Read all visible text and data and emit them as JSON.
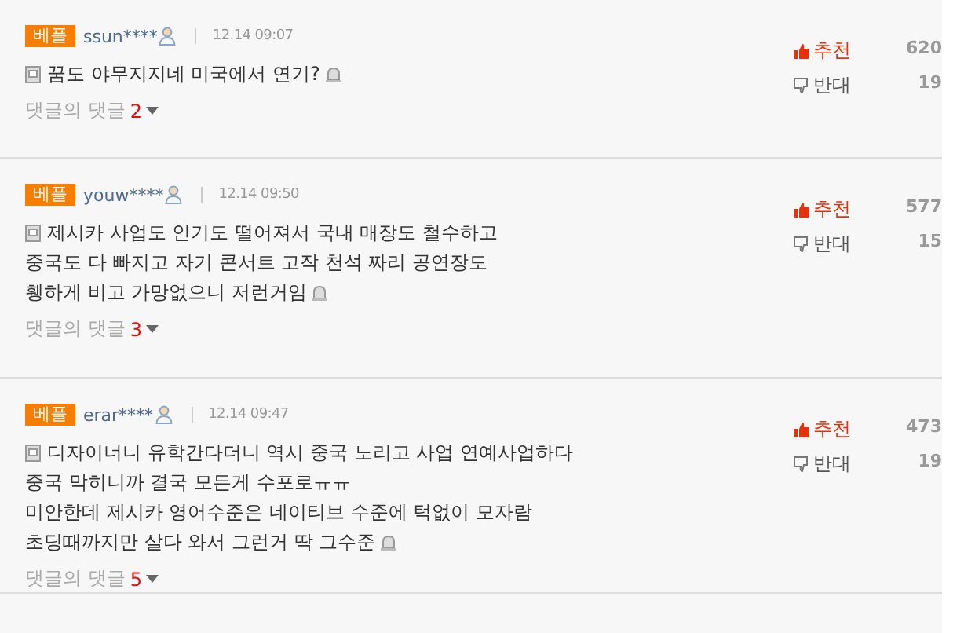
{
  "comments": [
    {
      "badge": "베플",
      "user": "ssun****",
      "time": "12.14 09:07",
      "lines": [
        "꿈도 야무지지네 미국에서 연기?"
      ],
      "replies_label": "댓글의 댓글",
      "replies_count": "2",
      "up_label": "추천",
      "up_count": "620",
      "down_label": "반대",
      "down_count": "19"
    },
    {
      "badge": "베플",
      "user": "youw****",
      "time": "12.14 09:50",
      "lines": [
        "제시카 사업도 인기도 떨어져서 국내 매장도 철수하고",
        "중국도 다 빠지고 자기 콘서트 고작 천석 짜리 공연장도",
        "휑하게 비고 가망없으니 저런거임"
      ],
      "replies_label": "댓글의 댓글",
      "replies_count": "3",
      "up_label": "추천",
      "up_count": "577",
      "down_label": "반대",
      "down_count": "15"
    },
    {
      "badge": "베플",
      "user": "erar****",
      "time": "12.14 09:47",
      "lines": [
        "디자이너니 유학간다더니 역시 중국 노리고 사업 연예사업하다",
        "중국 막히니까 결국 모든게 수포로ㅠㅠ",
        "미안한데 제시카 영어수준은 네이티브 수준에 턱없이 모자람",
        "초딩때까지만 살다 와서 그런거 딱 그수준"
      ],
      "replies_label": "댓글의 댓글",
      "replies_count": "5",
      "up_label": "추천",
      "up_count": "473",
      "down_label": "반대",
      "down_count": "19"
    }
  ]
}
